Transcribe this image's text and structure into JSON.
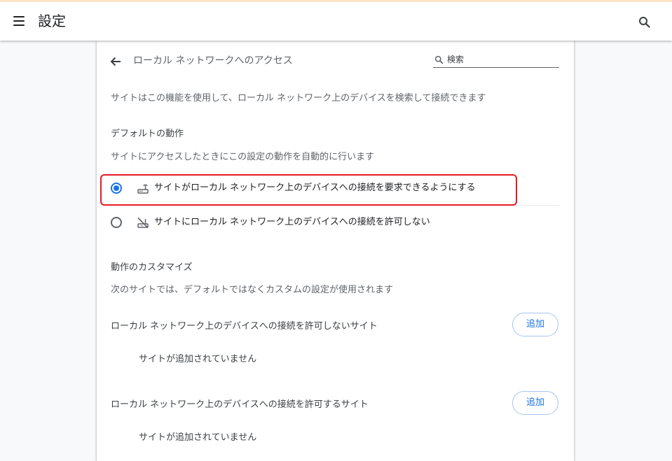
{
  "header": {
    "title": "設定",
    "menu_icon": "menu-icon",
    "search_icon": "search-icon"
  },
  "subpage": {
    "title": "ローカル ネットワークへのアクセス",
    "back_icon": "arrow-back-icon",
    "search": {
      "placeholder": "検索",
      "value": ""
    }
  },
  "description": "サイトはこの機能を使用して、ローカル ネットワーク上のデバイスを検索して接続できます",
  "default_behavior": {
    "heading": "デフォルトの動作",
    "subheading": "サイトにアクセスしたときにこの設定の動作を自動的に行います",
    "options": [
      {
        "label": "サイトがローカル ネットワーク上のデバイスへの接続を要求できるようにする",
        "icon": "router-icon",
        "selected": true,
        "highlighted": true
      },
      {
        "label": "サイトにローカル ネットワーク上のデバイスへの接続を許可しない",
        "icon": "router-off-icon",
        "selected": false
      }
    ]
  },
  "custom_behavior": {
    "heading": "動作のカスタマイズ",
    "subheading": "次のサイトでは、デフォルトではなくカスタムの設定が使用されます",
    "lists": [
      {
        "title": "ローカル ネットワーク上のデバイスへの接続を許可しないサイト",
        "add_label": "追加",
        "empty_text": "サイトが追加されていません"
      },
      {
        "title": "ローカル ネットワーク上のデバイスへの接続を許可するサイト",
        "add_label": "追加",
        "empty_text": "サイトが追加されていません"
      }
    ]
  },
  "colors": {
    "accent": "#1a73e8",
    "highlight_border": "#e51c23",
    "text_primary": "#202124",
    "text_secondary": "#5f6368"
  }
}
